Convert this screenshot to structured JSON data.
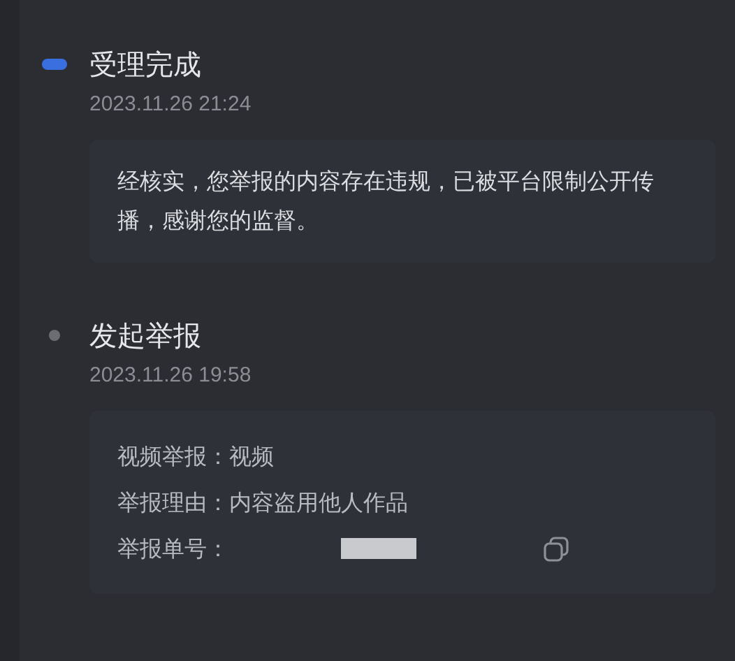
{
  "events": [
    {
      "title": "受理完成",
      "time": "2023.11.26 21:24",
      "current": true,
      "message": "经核实，您举报的内容存在违规，已被平台限制公开传播，感谢您的监督。"
    },
    {
      "title": "发起举报",
      "time": "2023.11.26 19:58",
      "current": false,
      "details": [
        {
          "label": "视频举报：",
          "value": "视频"
        },
        {
          "label": "举报理由：",
          "value": "内容盗用他人作品"
        },
        {
          "label": "举报单号：",
          "redacted": true,
          "copyable": true
        }
      ]
    }
  ]
}
